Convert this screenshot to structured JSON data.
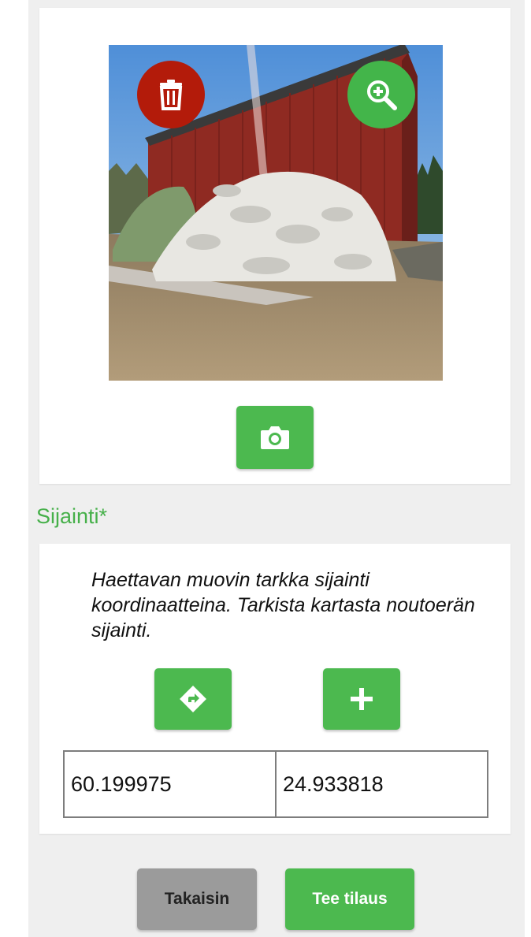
{
  "photo": {
    "delete_icon": "trash-icon",
    "zoom_icon": "zoom-in-icon",
    "camera_icon": "camera-icon"
  },
  "location": {
    "title": "Sijainti*",
    "description": "Haettavan muovin tarkka sijainti koordinaatteina. Tarkista kartasta noutoerän sijainti.",
    "directions_icon": "directions-icon",
    "add_icon": "plus-icon",
    "latitude": "60.199975",
    "longitude": "24.933818"
  },
  "actions": {
    "back_label": "Takaisin",
    "order_label": "Tee tilaus"
  },
  "colors": {
    "primary_green": "#4cb94f",
    "delete_red": "#b31b0a",
    "title_green": "#46b04a",
    "back_gray": "#9b9b9b"
  }
}
